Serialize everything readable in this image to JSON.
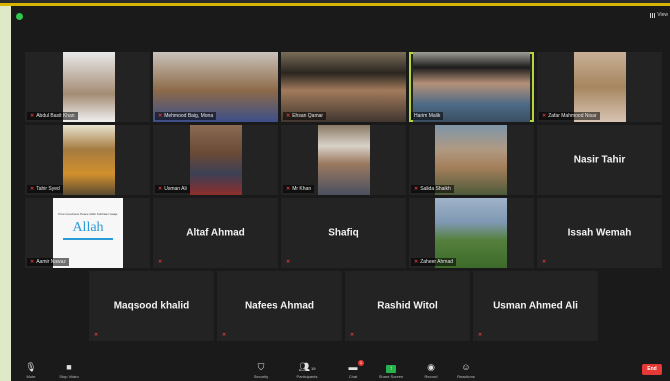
{
  "app": {
    "view_label": "View"
  },
  "tiles_row1": [
    {
      "name": "Abdul Basit Khan",
      "colors": [
        "#9a9a9a",
        "#b8a48c"
      ]
    },
    {
      "name": "Mehmood Baig, Mona",
      "colors": [
        "#b7b1a8",
        "#6b4a2a"
      ]
    },
    {
      "name": "Ehsan Qamar",
      "colors": [
        "#6a5e4c",
        "#3a3128"
      ]
    },
    {
      "name": "Harim Malik",
      "colors": [
        "#8f8f89",
        "#3f566a"
      ]
    },
    {
      "name": "Zafar Mahmood Nisar",
      "colors": [
        "#a68a66",
        "#c8a990"
      ]
    }
  ],
  "tiles_row2": [
    {
      "name": "Tahir Syed",
      "colors": [
        "#5a4a33",
        "#c78b2a"
      ]
    },
    {
      "name": "Usman Ali",
      "colors": [
        "#7a5a44",
        "#3d3f52"
      ]
    },
    {
      "name": "Mr Khan",
      "colors": [
        "#7b6b55",
        "#4a4a4a"
      ]
    },
    {
      "name": "Salida Shaikh",
      "colors": [
        "#7c8e9e",
        "#a57f5b"
      ]
    },
    {
      "name": "Nasir Tahir",
      "big": true
    }
  ],
  "tiles_row3": [
    {
      "name": "Aamir Nawaz",
      "placard_line": "Pure Goodness Peace Allah Subhaan Gaaje",
      "placard_word": "Allah"
    },
    {
      "name": "Altaf Ahmad",
      "big": true
    },
    {
      "name": "Shafiq",
      "big": true
    },
    {
      "name": "Zaheer Ahmad",
      "colors": [
        "#8da3bd",
        "#3f6b2e"
      ]
    },
    {
      "name": "Issah Wemah",
      "big": true
    }
  ],
  "tiles_row4": [
    {
      "name": "Maqsood khalid"
    },
    {
      "name": "Nafees Ahmad"
    },
    {
      "name": "Rashid Witol"
    },
    {
      "name": "Usman Ahmed Ali"
    }
  ],
  "toolbar": {
    "mute": "Mute",
    "video": "Stop Video",
    "security": "Security",
    "participants": "Participants",
    "participants_count": "19",
    "chat": "Chat",
    "chat_badge": "1",
    "share": "Share Screen",
    "record": "Record",
    "reactions": "Reactions",
    "end": "End"
  },
  "colors": {
    "active_border": "#b5d63a",
    "end_red": "#e53935",
    "share_green": "#28b24b",
    "bezel_gold": "#d8b400"
  }
}
